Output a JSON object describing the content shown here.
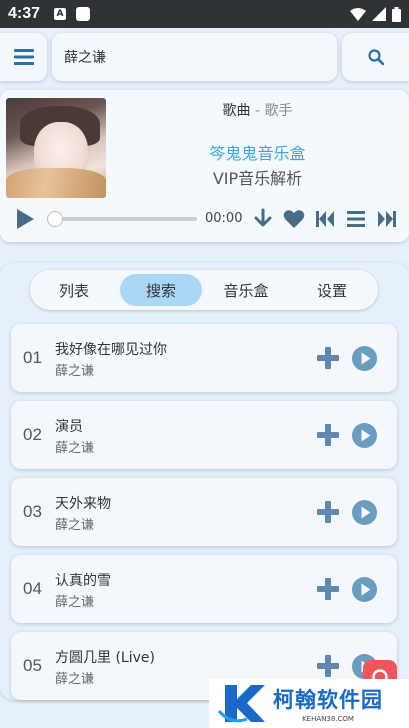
{
  "status_bar": {
    "time": "4:37",
    "notif_letter": "A"
  },
  "search": {
    "value": "薛之谦"
  },
  "player": {
    "song_label": "歌曲",
    "separator": " - ",
    "artist_label": "歌手",
    "title": "笒鬼鬼音乐盒",
    "subtitle": "VIP音乐解析",
    "time": "00:00",
    "progress": 0
  },
  "tabs": [
    {
      "label": "列表",
      "active": false
    },
    {
      "label": "搜索",
      "active": true
    },
    {
      "label": "音乐盒",
      "active": false
    },
    {
      "label": "设置",
      "active": false
    }
  ],
  "songs": [
    {
      "num": "01",
      "title": "我好像在哪见过你",
      "artist": "薛之谦"
    },
    {
      "num": "02",
      "title": "演员",
      "artist": "薛之谦"
    },
    {
      "num": "03",
      "title": "天外来物",
      "artist": "薛之谦"
    },
    {
      "num": "04",
      "title": "认真的雪",
      "artist": "薛之谦"
    },
    {
      "num": "05",
      "title": "方圆几里 (Live)",
      "artist": "薛之谦"
    }
  ],
  "watermark": {
    "title": "柯翰软件园",
    "url": "KEHAN38.COM"
  },
  "colors": {
    "accent": "#3ba6dd",
    "icon": "#4a6b86",
    "play_icon": "#6a9cbf",
    "tab_active": "#a9d7f4"
  }
}
